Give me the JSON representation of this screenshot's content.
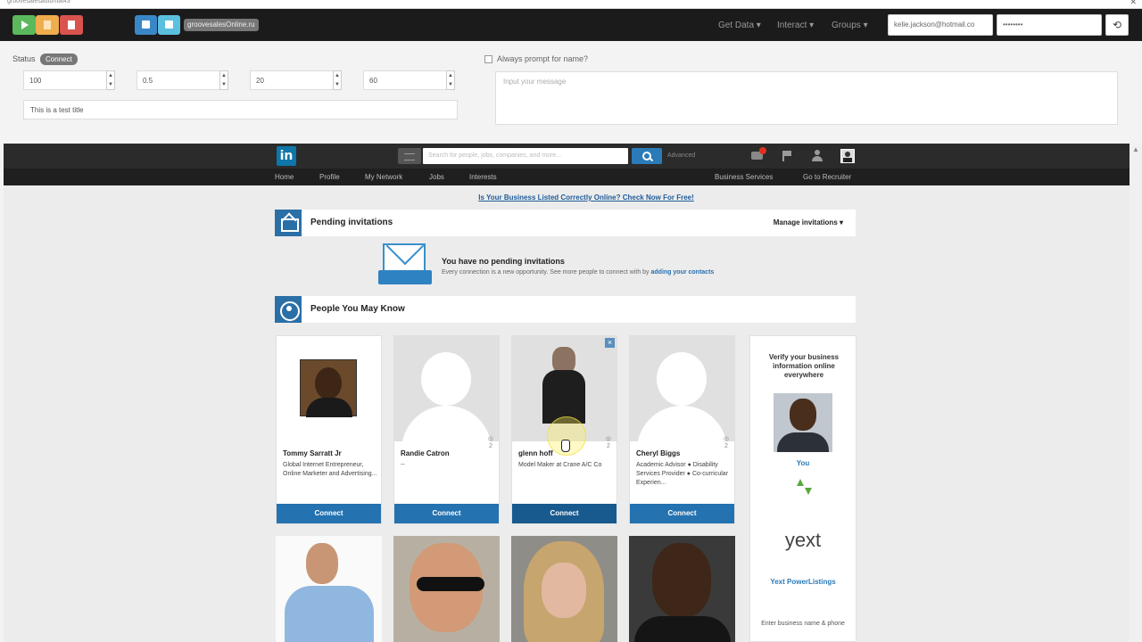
{
  "window": {
    "title": "groovesalesautomat43",
    "close_glyph": "✕"
  },
  "toolbar": {
    "account_badge": "groovesalesOnline.ru",
    "menus": [
      "Get Data",
      "Interact",
      "Groups"
    ],
    "email_value": "kelie.jackson@hotmail.co",
    "password_value": "••••••••",
    "refresh_glyph": "⟲"
  },
  "settings": {
    "status_label": "Status",
    "status_value": "Connect",
    "fields": [
      "100",
      "0.5",
      "20",
      "60"
    ],
    "title_value": "This is a test title",
    "prompt_label": "Always prompt for name?",
    "message_placeholder": "Input your message"
  },
  "linkedin": {
    "logo": "in",
    "search_placeholder": "Search for people, jobs, companies, and more...",
    "advanced": "Advanced",
    "nav": [
      "Home",
      "Profile",
      "My Network",
      "Jobs",
      "Interests"
    ],
    "nav_right": [
      "Business Services",
      "Go to Recruiter"
    ],
    "banner_link": "Is Your Business Listed Correctly Online? Check Now For Free!",
    "pending": {
      "title": "Pending invitations",
      "manage": "Manage invitations ▾",
      "empty_title": "You have no pending invitations",
      "empty_text": "Every connection is a new opportunity. See more people to connect with by",
      "empty_link": "adding your contacts"
    },
    "pymk": {
      "title": "People You May Know",
      "people": [
        {
          "name": "Tommy Sarratt Jr",
          "headline": "Global Internet Entrepreneur, Online Marketer and Advertising...",
          "connect": "Connect",
          "shared": ""
        },
        {
          "name": "Randie Catron",
          "headline": "--",
          "connect": "Connect",
          "shared": "2"
        },
        {
          "name": "glenn hoff",
          "headline": "Model Maker at Crane A/C Co",
          "connect": "Connect",
          "shared": "2"
        },
        {
          "name": "Cheryl Biggs",
          "headline": "Academic Advisor ● Disability Services Provider ● Co-curricular Experien...",
          "connect": "Connect",
          "shared": "2"
        }
      ]
    },
    "ad": {
      "headline": "Verify your business information online everywhere",
      "you": "You",
      "brand": "yext",
      "brand_label": "Yext PowerListings",
      "enter_text": "Enter business name & phone"
    }
  },
  "colors": {
    "accent": "#2472b0",
    "linkedin_blue": "#0e76a8",
    "toolbar_bg": "#1b1b1b"
  }
}
